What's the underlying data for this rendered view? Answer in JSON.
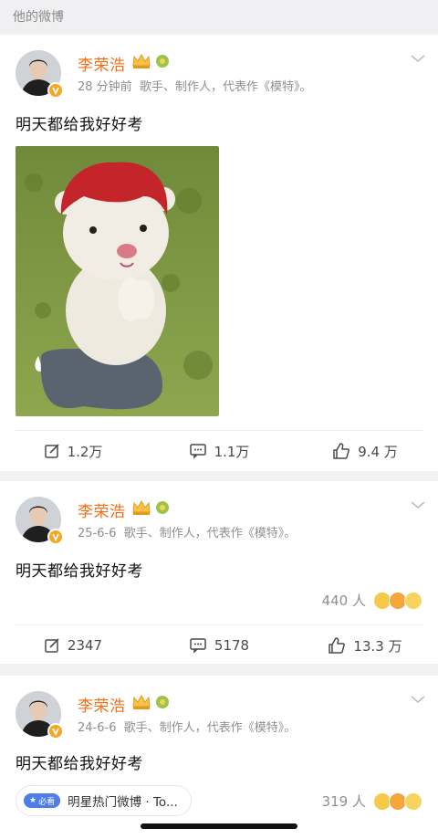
{
  "section": {
    "title": "他的微博"
  },
  "posts": [
    {
      "author": "李荣浩",
      "time": "28 分钟前",
      "bio": "歌手、制作人，代表作《模特》。",
      "text": "明天都给我好好考",
      "actions": {
        "repost": "1.2万",
        "comment": "1.1万",
        "like": "9.4 万"
      }
    },
    {
      "author": "李荣浩",
      "time": "25-6-6",
      "bio": "歌手、制作人，代表作《模特》。",
      "text": "明天都给我好好考",
      "reactions": "440 人",
      "actions": {
        "repost": "2347",
        "comment": "5178",
        "like": "13.3 万"
      }
    },
    {
      "author": "李荣浩",
      "time": "24-6-6",
      "bio": "歌手、制作人，代表作《模特》。",
      "text": "明天都给我好好考",
      "hot_tag": {
        "badge": "必看",
        "label": "明星热门微博 · To..."
      },
      "reactions": "319 人"
    }
  ],
  "colors": {
    "name": "#f36d15",
    "badge": "#f5a623",
    "hot_badge": "#4e7de9"
  },
  "icons": [
    "chevron-down-icon",
    "crown-icon",
    "fan-icon",
    "verified-icon",
    "repost-icon",
    "comment-icon",
    "like-icon"
  ]
}
